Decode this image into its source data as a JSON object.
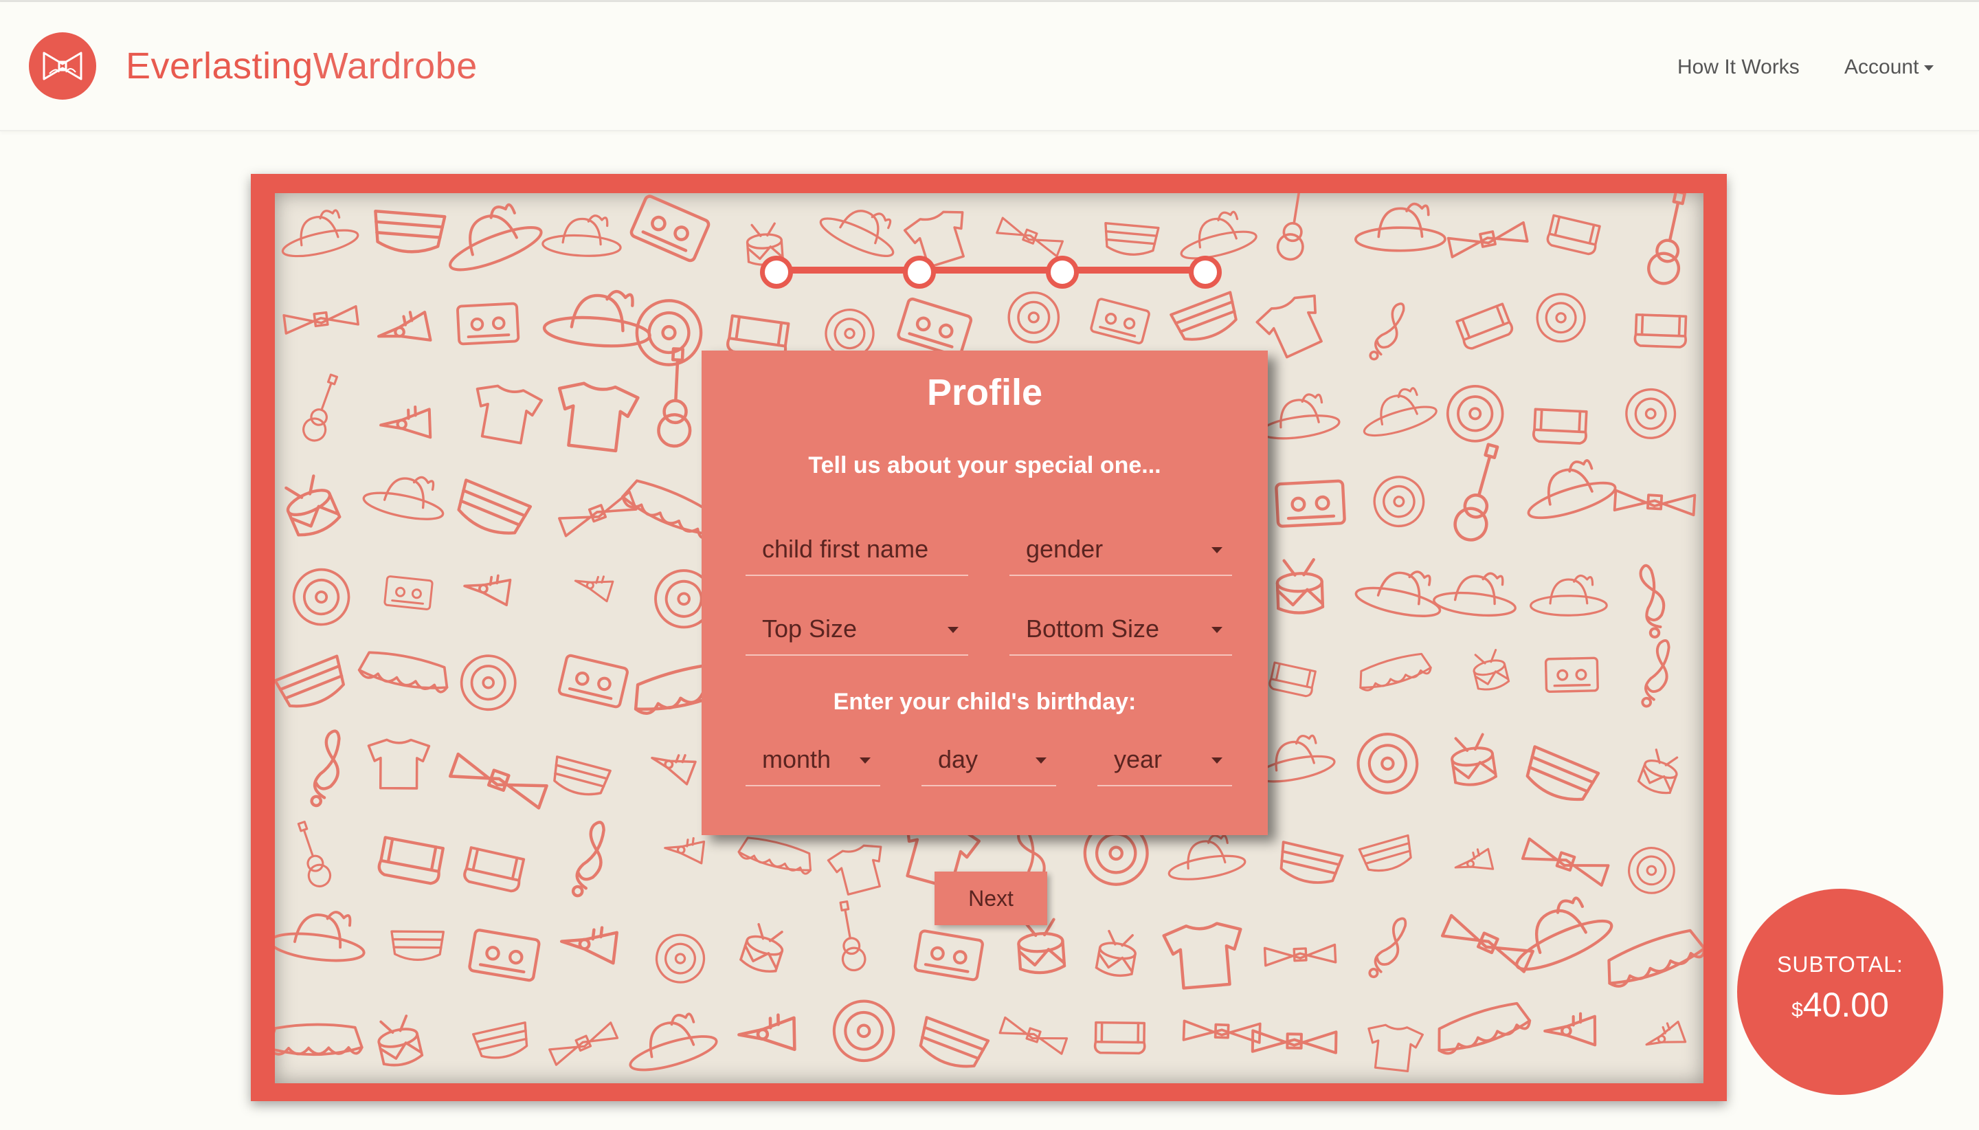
{
  "header": {
    "brand_part1": "Everlasting",
    "brand_part2": "Wardrobe",
    "logo_icon": "bow-tie-icon",
    "nav": {
      "how_it_works": "How It Works",
      "account": "Account"
    }
  },
  "progress": {
    "steps": 4,
    "current_step": 1
  },
  "profile_card": {
    "title": "Profile",
    "subtitle": "Tell us about your special one...",
    "fields": {
      "child_first_name": "child first name",
      "gender": "gender",
      "top_size": "Top Size",
      "bottom_size": "Bottom Size"
    },
    "birthday_prompt": "Enter your child's birthday:",
    "birthday": {
      "month": "month",
      "day": "day",
      "year": "year"
    }
  },
  "next_button": "Next",
  "subtotal": {
    "label": "SUBTOTAL:",
    "currency": "$",
    "amount": "40.00"
  },
  "colors": {
    "brand": "#e85a4f",
    "card": "#e97d70",
    "pattern_bg": "#ece6db",
    "page_bg": "#fcfcf7"
  }
}
